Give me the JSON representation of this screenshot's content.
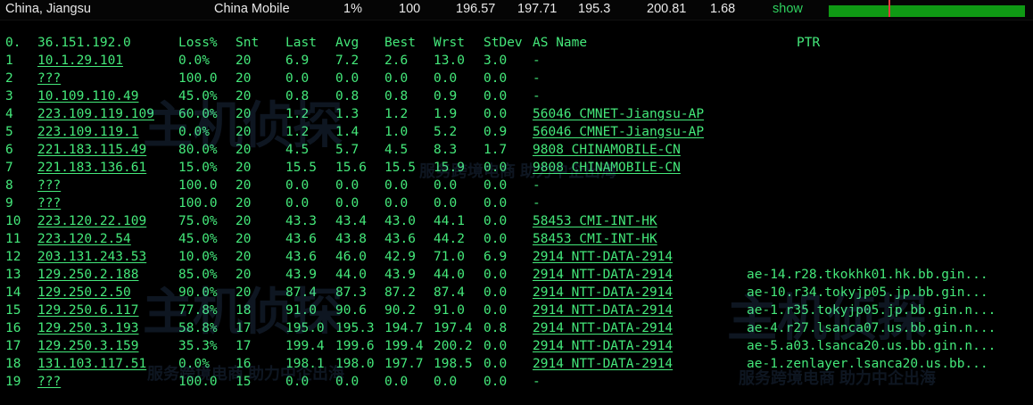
{
  "summary": {
    "location": "China, Jiangsu",
    "isp": "China Mobile",
    "loss": "1%",
    "count": "100",
    "v1": "196.57",
    "v2": "197.71",
    "v3": "195.3",
    "v4": "200.81",
    "v5": "1.68",
    "show_label": "show"
  },
  "table": {
    "headers": [
      "0.",
      "36.151.192.0",
      "Loss%",
      "Snt",
      "Last",
      "Avg",
      "Best",
      "Wrst",
      "StDev",
      "AS Name",
      "PTR"
    ],
    "rows": [
      [
        "1",
        "10.1.29.101",
        "0.0%",
        "20",
        "6.9",
        "7.2",
        "2.6",
        "13.0",
        "3.0",
        "-",
        ""
      ],
      [
        "2",
        "???",
        "100.0",
        "20",
        "0.0",
        "0.0",
        "0.0",
        "0.0",
        "0.0",
        "-",
        ""
      ],
      [
        "3",
        "10.109.110.49",
        "45.0%",
        "20",
        "0.8",
        "0.8",
        "0.8",
        "0.9",
        "0.0",
        "-",
        ""
      ],
      [
        "4",
        "223.109.119.109",
        "60.0%",
        "20",
        "1.2",
        "1.3",
        "1.2",
        "1.9",
        "0.0",
        "56046 CMNET-Jiangsu-AP",
        ""
      ],
      [
        "5",
        "223.109.119.1",
        "0.0%",
        "20",
        "1.2",
        "1.4",
        "1.0",
        "5.2",
        "0.9",
        "56046 CMNET-Jiangsu-AP",
        ""
      ],
      [
        "6",
        "221.183.115.49",
        "80.0%",
        "20",
        "4.5",
        "5.7",
        "4.5",
        "8.3",
        "1.7",
        "9808  CHINAMOBILE-CN",
        ""
      ],
      [
        "7",
        "221.183.136.61",
        "15.0%",
        "20",
        "15.5",
        "15.6",
        "15.5",
        "15.9",
        "0.0",
        "9808  CHINAMOBILE-CN",
        ""
      ],
      [
        "8",
        "???",
        "100.0",
        "20",
        "0.0",
        "0.0",
        "0.0",
        "0.0",
        "0.0",
        "-",
        ""
      ],
      [
        "9",
        "???",
        "100.0",
        "20",
        "0.0",
        "0.0",
        "0.0",
        "0.0",
        "0.0",
        "-",
        ""
      ],
      [
        "10",
        "223.120.22.109",
        "75.0%",
        "20",
        "43.3",
        "43.4",
        "43.0",
        "44.1",
        "0.0",
        "58453 CMI-INT-HK",
        ""
      ],
      [
        "11",
        "223.120.2.54",
        "45.0%",
        "20",
        "43.6",
        "43.8",
        "43.6",
        "44.2",
        "0.0",
        "58453 CMI-INT-HK",
        ""
      ],
      [
        "12",
        "203.131.243.53",
        "10.0%",
        "20",
        "43.6",
        "46.0",
        "42.9",
        "71.0",
        "6.9",
        "2914  NTT-DATA-2914",
        ""
      ],
      [
        "13",
        "129.250.2.188",
        "85.0%",
        "20",
        "43.9",
        "44.0",
        "43.9",
        "44.0",
        "0.0",
        "2914  NTT-DATA-2914",
        "ae-14.r28.tkokhk01.hk.bb.gin..."
      ],
      [
        "14",
        "129.250.2.50",
        "90.0%",
        "20",
        "87.4",
        "87.3",
        "87.2",
        "87.4",
        "0.0",
        "2914  NTT-DATA-2914",
        "ae-10.r34.tokyjp05.jp.bb.gin..."
      ],
      [
        "15",
        "129.250.6.117",
        "77.8%",
        "18",
        "91.0",
        "90.6",
        "90.2",
        "91.0",
        "0.0",
        "2914  NTT-DATA-2914",
        "ae-1.r35.tokyjp05.jp.bb.gin.n..."
      ],
      [
        "16",
        "129.250.3.193",
        "58.8%",
        "17",
        "195.0",
        "195.3",
        "194.7",
        "197.4",
        "0.8",
        "2914  NTT-DATA-2914",
        "ae-4.r27.lsanca07.us.bb.gin.n..."
      ],
      [
        "17",
        "129.250.3.159",
        "35.3%",
        "17",
        "199.4",
        "199.6",
        "199.4",
        "200.2",
        "0.0",
        "2914  NTT-DATA-2914",
        "ae-5.a03.lsanca20.us.bb.gin.n..."
      ],
      [
        "18",
        "131.103.117.51",
        "0.0%",
        "16",
        "198.1",
        "198.0",
        "197.7",
        "198.5",
        "0.0",
        "2914  NTT-DATA-2914",
        "ae-1.zenlayer.lsanca20.us.bb..."
      ],
      [
        "19",
        "???",
        "100.0",
        "15",
        "0.0",
        "0.0",
        "0.0",
        "0.0",
        "0.0",
        "-",
        ""
      ]
    ]
  },
  "watermark": {
    "title": "主机侦探",
    "subtitle": "服务跨境电商 助力中企出海"
  },
  "colors": {
    "text": "#44e87a",
    "bar": "#0f9a14",
    "marker": "#e53b3b"
  }
}
